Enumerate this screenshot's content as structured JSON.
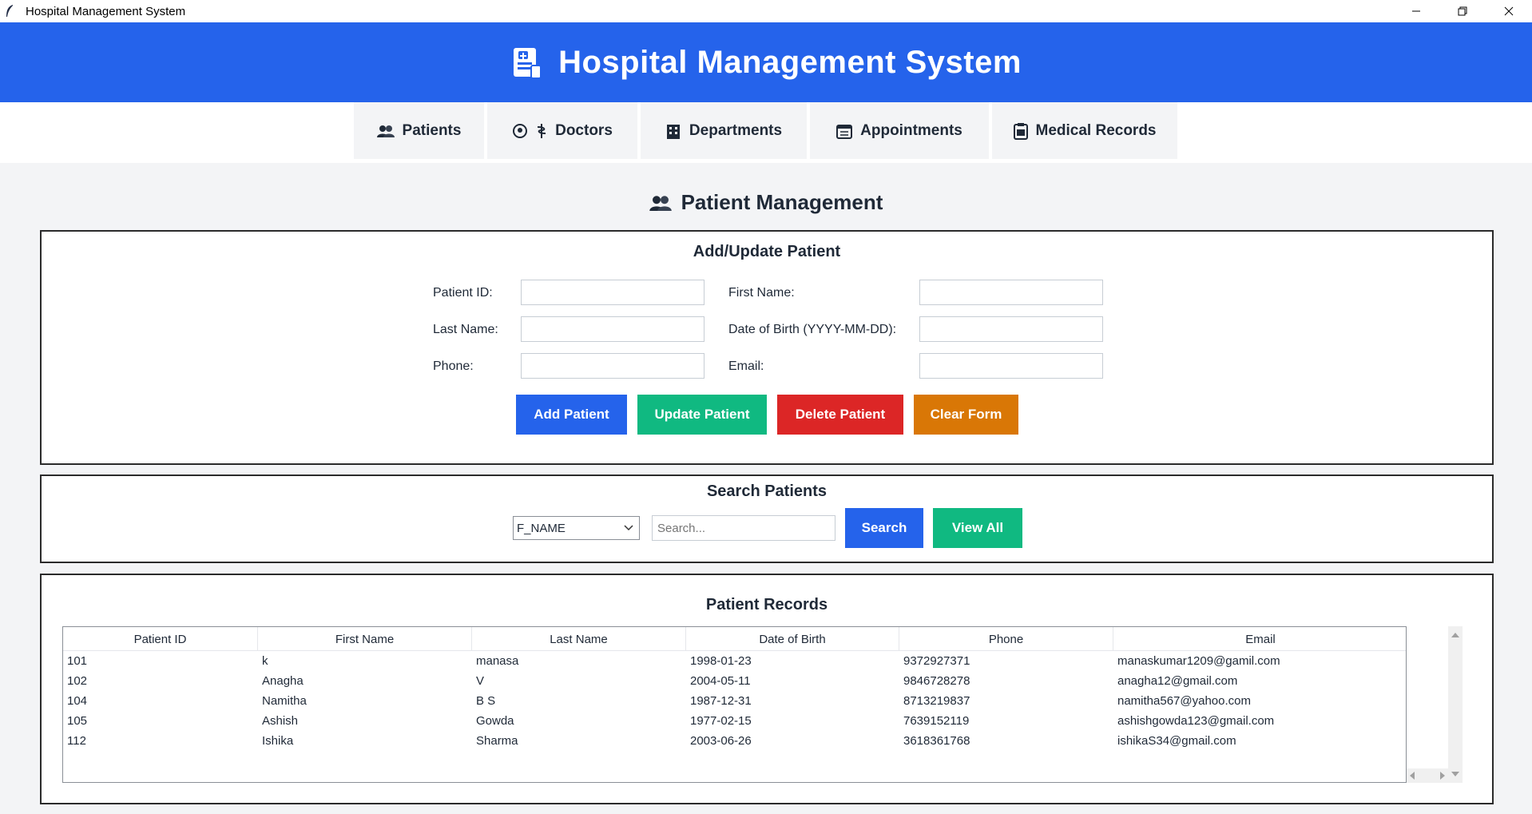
{
  "window": {
    "title": "Hospital Management System"
  },
  "banner": {
    "title": "Hospital Management System"
  },
  "nav": {
    "tabs": [
      {
        "label": "Patients"
      },
      {
        "label": "Doctors"
      },
      {
        "label": "Departments"
      },
      {
        "label": "Appointments"
      },
      {
        "label": "Medical Records"
      }
    ]
  },
  "page": {
    "title": "Patient Management"
  },
  "form": {
    "title": "Add/Update Patient",
    "patient_id_label": "Patient ID:",
    "first_name_label": "First Name:",
    "last_name_label": "Last Name:",
    "dob_label": "Date of Birth (YYYY-MM-DD):",
    "phone_label": "Phone:",
    "email_label": "Email:",
    "patient_id_value": "",
    "first_name_value": "",
    "last_name_value": "",
    "dob_value": "",
    "phone_value": "",
    "email_value": "",
    "add_label": "Add Patient",
    "update_label": "Update Patient",
    "delete_label": "Delete Patient",
    "clear_label": "Clear Form"
  },
  "search": {
    "title": "Search Patients",
    "field_selected": "F_NAME",
    "placeholder": "Search...",
    "search_label": "Search",
    "view_all_label": "View All"
  },
  "records": {
    "title": "Patient Records",
    "columns": [
      "Patient ID",
      "First Name",
      "Last Name",
      "Date of Birth",
      "Phone",
      "Email"
    ],
    "rows": [
      [
        "101",
        "k",
        "manasa",
        "1998-01-23",
        "9372927371",
        "manaskumar1209@gamil.com"
      ],
      [
        "102",
        "Anagha",
        "V",
        "2004-05-11",
        "9846728278",
        "anagha12@gmail.com"
      ],
      [
        "104",
        "Namitha",
        "B S",
        "1987-12-31",
        "8713219837",
        "namitha567@yahoo.com"
      ],
      [
        "105",
        "Ashish",
        "Gowda",
        "1977-02-15",
        "7639152119",
        "ashishgowda123@gmail.com"
      ],
      [
        "112",
        "Ishika",
        "Sharma",
        "2003-06-26",
        "3618361768",
        "ishikaS34@gmail.com"
      ]
    ]
  },
  "colors": {
    "primary_blue": "#2563eb",
    "success_green": "#10b981",
    "danger_red": "#dc2626",
    "warning_orange": "#d97706"
  }
}
